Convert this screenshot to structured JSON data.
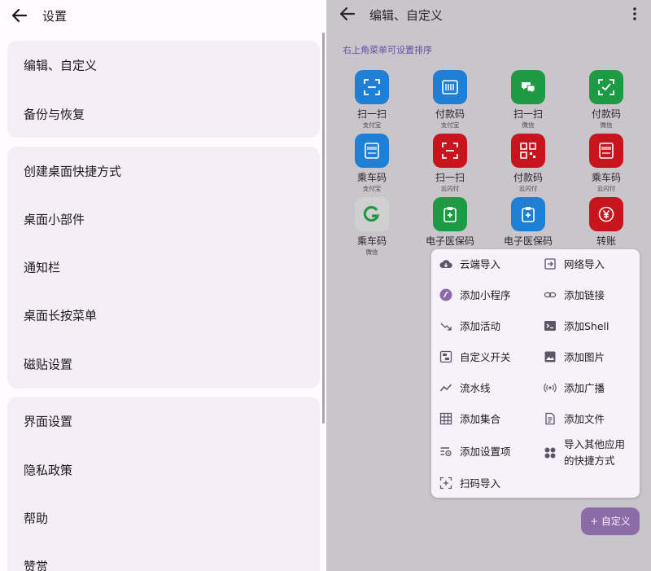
{
  "left": {
    "title": "设置",
    "groups": [
      [
        "编辑、自定义",
        "备份与恢复"
      ],
      [
        "创建桌面快捷方式",
        "桌面小部件",
        "通知栏",
        "桌面长按菜单",
        "磁贴设置"
      ],
      [
        "界面设置",
        "隐私政策",
        "帮助",
        "赞赏"
      ]
    ]
  },
  "right": {
    "title": "编辑、自定义",
    "hint": "右上角菜单可设置排序",
    "tiles": [
      {
        "name": "扫一扫",
        "sub": "支付宝",
        "color": "#1f7fd4",
        "icon": "scan-icon"
      },
      {
        "name": "付款码",
        "sub": "支付宝",
        "color": "#1f7fd4",
        "icon": "barcode-icon"
      },
      {
        "name": "扫一扫",
        "sub": "微信",
        "color": "#1e9a44",
        "icon": "wechat-scan-icon"
      },
      {
        "name": "付款码",
        "sub": "微信",
        "color": "#1e9a44",
        "icon": "wechat-pay-icon"
      },
      {
        "name": "乘车码",
        "sub": "支付宝",
        "color": "#1f7fd4",
        "icon": "bus-card-icon"
      },
      {
        "name": "扫一扫",
        "sub": "云闪付",
        "color": "#c8151d",
        "icon": "scan-icon"
      },
      {
        "name": "付款码",
        "sub": "云闪付",
        "color": "#c8151d",
        "icon": "qrcode-icon"
      },
      {
        "name": "乘车码",
        "sub": "云闪付",
        "color": "#c8151d",
        "icon": "bus-card-icon"
      },
      {
        "name": "乘车码",
        "sub": "微信",
        "color": "#d0d0d0",
        "icon": "wechat-bus-icon"
      },
      {
        "name": "电子医保码",
        "sub": "",
        "color": "#1e9a44",
        "icon": "medical-card-icon"
      },
      {
        "name": "电子医保码",
        "sub": "",
        "color": "#1f7fd4",
        "icon": "medical-card-icon"
      },
      {
        "name": "转账",
        "sub": "",
        "color": "#c8151d",
        "icon": "yuan-transfer-icon"
      }
    ],
    "menu": [
      {
        "label": "云端导入",
        "icon": "cloud-download-icon"
      },
      {
        "label": "网络导入",
        "icon": "import-icon"
      },
      {
        "label": "添加小程序",
        "icon": "mini-program-icon"
      },
      {
        "label": "添加链接",
        "icon": "link-icon"
      },
      {
        "label": "添加活动",
        "icon": "activity-icon"
      },
      {
        "label": "添加Shell",
        "icon": "terminal-icon"
      },
      {
        "label": "自定义开关",
        "icon": "toggle-icon"
      },
      {
        "label": "添加图片",
        "icon": "image-icon"
      },
      {
        "label": "流水线",
        "icon": "workflow-icon"
      },
      {
        "label": "添加广播",
        "icon": "broadcast-icon"
      },
      {
        "label": "添加集合",
        "icon": "grid-icon"
      },
      {
        "label": "添加文件",
        "icon": "file-icon"
      },
      {
        "label": "添加设置项",
        "icon": "settings-item-icon"
      },
      {
        "label": "导入其他应用\n的快捷方式",
        "icon": "apps-icon"
      },
      {
        "label": "扫码导入",
        "icon": "scan-import-icon"
      }
    ],
    "fab": "+ 自定义",
    "accent": "#8d6aa8"
  }
}
